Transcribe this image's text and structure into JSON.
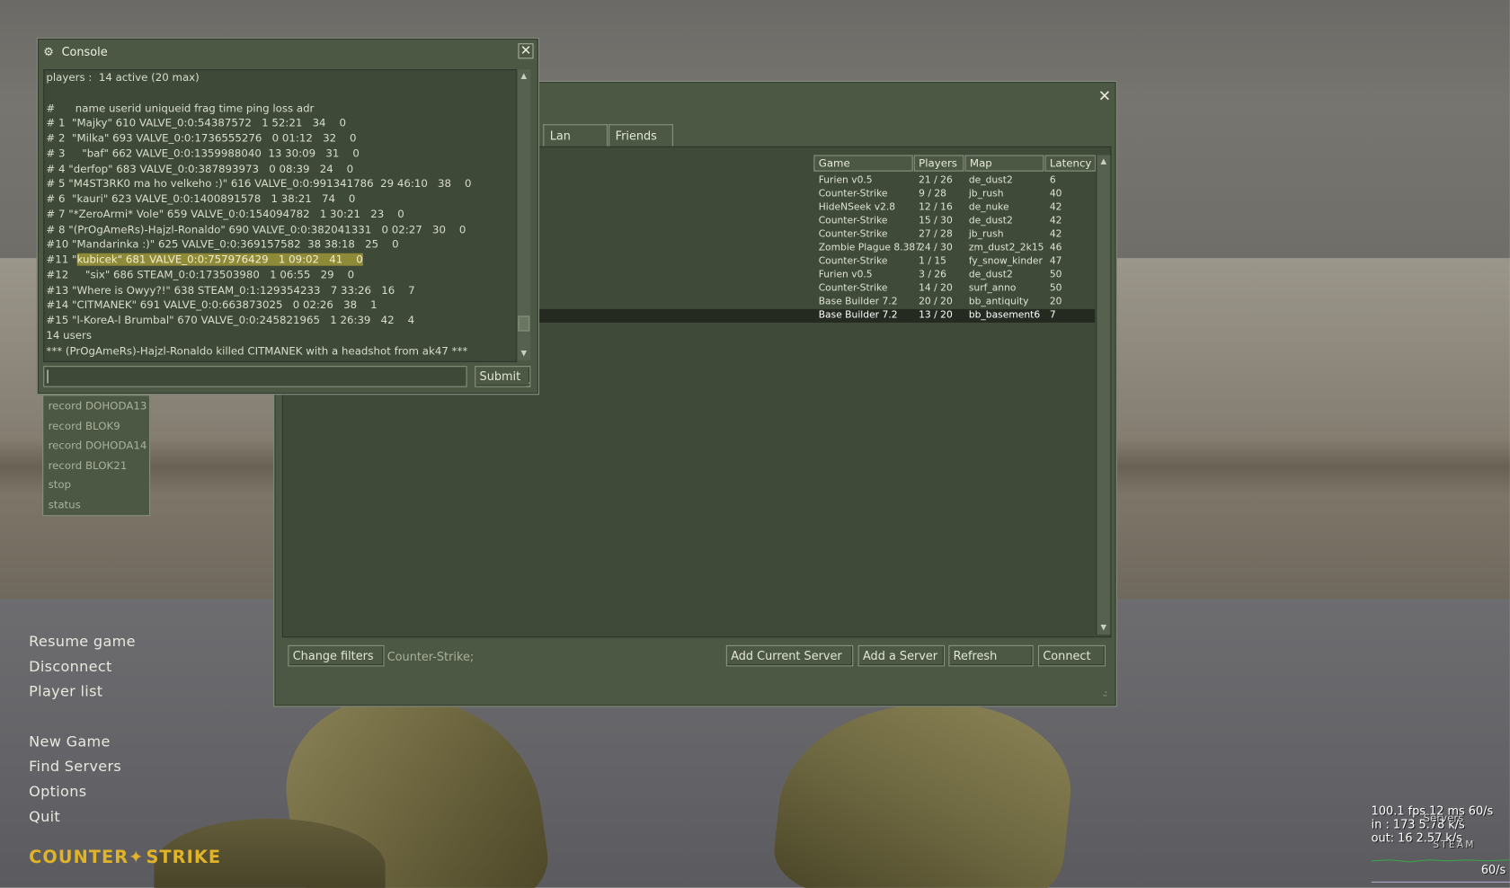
{
  "console": {
    "title": "Console",
    "lines": [
      "players :  14 active (20 max)",
      "",
      "#      name userid uniqueid frag time ping loss adr",
      "# 1  \"Majky\" 610 VALVE_0:0:54387572   1 52:21   34    0",
      "# 2  \"Milka\" 693 VALVE_0:0:1736555276   0 01:12   32    0",
      "# 3     \"baf\" 662 VALVE_0:0:1359988040  13 30:09   31    0",
      "# 4 \"derfop\" 683 VALVE_0:0:387893973   0 08:39   24    0",
      "# 5 \"M4ST3RK0 ma ho velkeho :)\" 616 VALVE_0:0:991341786  29 46:10   38    0",
      "# 6  \"kauri\" 623 VALVE_0:0:1400891578   1 38:21   74    0",
      "# 7 \"*ZeroArmi* Vole\" 659 VALVE_0:0:154094782   1 30:21   23    0",
      "# 8 \"(PrOgAmeRs)-Hajzl-Ronaldo\" 690 VALVE_0:0:382041331   0 02:27   30    0",
      "#10 \"Mandarinka :)\" 625 VALVE_0:0:369157582  38 38:18   25    0",
      "#11 \"kubicek\" 681 VALVE_0:0:757976429   1 09:02   41    0",
      "#12     \"six\" 686 STEAM_0:0:173503980   1 06:55   29    0",
      "#13 \"Where is Owyy?!\" 638 STEAM_0:1:129354233   7 33:26   16    7",
      "#14 \"CITMANEK\" 691 VALVE_0:0:663873025   0 02:26   38    1",
      "#15 \"l-KoreA-l Brumbal\" 670 VALVE_0:0:245821965   1 26:39   42    4",
      "14 users",
      "*** (PrOgAmeRs)-Hajzl-Ronaldo killed CITMANEK with a headshot from ak47 ***"
    ],
    "line11_prefix": "#11 \"",
    "line11_highlight": "kubicek\" 681 VALVE_0:0:757976429   1 09:02   41    0",
    "input_value": "",
    "submit_label": "Submit"
  },
  "autocomplete": {
    "items": [
      "record DOHODA13",
      "record BLOK9",
      "record DOHODA14",
      "record BLOK21",
      "stop",
      "status"
    ]
  },
  "browser": {
    "tabs": [
      "Lan",
      "Friends"
    ],
    "columns": [
      "Game",
      "Players",
      "Map",
      "Latency"
    ],
    "rows": [
      {
        "game": "Furien v0.5",
        "players": "21 / 26",
        "map": "de_dust2",
        "latency": "6"
      },
      {
        "game": "Counter-Strike",
        "players": "9 / 28",
        "map": "jb_rush",
        "latency": "40"
      },
      {
        "game": "HideNSeek v2.8",
        "players": "12 / 16",
        "map": "de_nuke",
        "latency": "42"
      },
      {
        "game": "Counter-Strike",
        "players": "15 / 30",
        "map": "de_dust2",
        "latency": "42"
      },
      {
        "game": "Counter-Strike",
        "players": "27 / 28",
        "map": "jb_rush",
        "latency": "42"
      },
      {
        "game": "Zombie Plague 8.387",
        "players": "24 / 30",
        "map": "zm_dust2_2k15",
        "latency": "46"
      },
      {
        "game": "Counter-Strike",
        "players": "1 / 15",
        "map": "fy_snow_kinder",
        "latency": "47"
      },
      {
        "game": "Furien v0.5",
        "players": "3 / 26",
        "map": "de_dust2",
        "latency": "50"
      },
      {
        "game": "Counter-Strike",
        "players": "14 / 20",
        "map": "surf_anno",
        "latency": "50"
      },
      {
        "game": "Base Builder 7.2",
        "players": "20 / 20",
        "map": "bb_antiquity",
        "latency": "20"
      },
      {
        "game": "Base Builder 7.2",
        "players": "13 / 20",
        "map": "bb_basement6",
        "latency": "7"
      }
    ],
    "selected_row": 10,
    "change_filters_label": "Change filters",
    "filter_text": "Counter-Strike;",
    "add_current_label": "Add Current Server",
    "add_server_label": "Add a Server",
    "refresh_label": "Refresh",
    "connect_label": "Connect"
  },
  "main_menu": {
    "items": [
      "Resume game",
      "Disconnect",
      "Player list",
      "New Game",
      "Find Servers",
      "Options",
      "Quit"
    ],
    "logo_left": "COUNTER",
    "logo_right": "STRIKE"
  },
  "netgraph": {
    "line1": "100.1 fps  12 ms  60/s",
    "line2": "in :  173  5.78 k/s",
    "line3": "out:  16  2.57 k/s",
    "overlay_servers": "Servers",
    "overlay_steam": "STEAM",
    "bottom_rate": "60/s"
  },
  "colors": {
    "panel": "#4c5844",
    "highlight": "#8f8a38",
    "logo": "#e0b328"
  },
  "icons": {
    "console_title_icon": "steam-icon",
    "close": "close-icon"
  }
}
